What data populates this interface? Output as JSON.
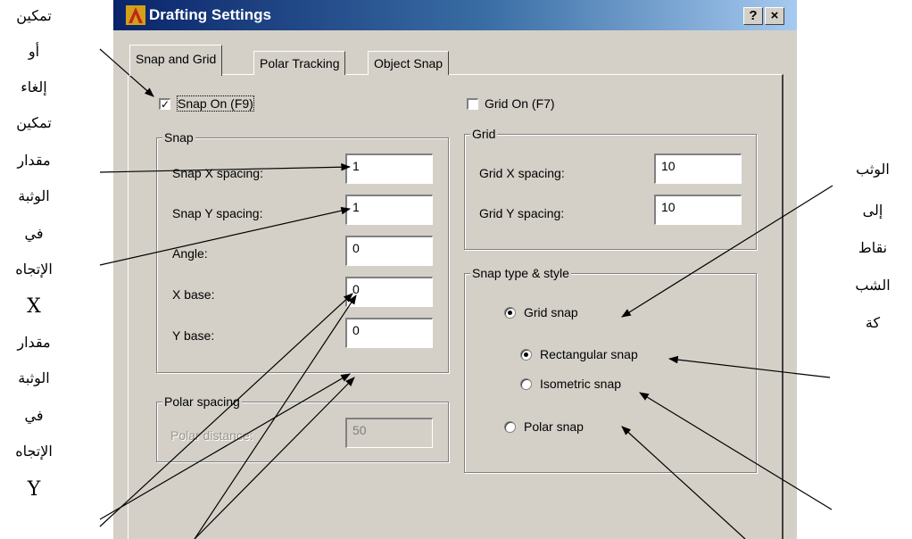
{
  "annotations": {
    "left": [
      "تمكين",
      "أو",
      "إلغاء",
      "تمكين",
      "مقدار",
      "الوثبة",
      "في",
      "الإتجاه",
      "X",
      "مقدار",
      "الوثبة",
      "في",
      "الإتجاه",
      "Y"
    ],
    "right": [
      "الوثب",
      "إلى",
      "نقاط",
      "الشب",
      "كة"
    ]
  },
  "window": {
    "title": "Drafting Settings",
    "help_button": "?",
    "close_button": "×"
  },
  "tabs": [
    {
      "label": "Snap and Grid",
      "active": true
    },
    {
      "label": "Polar Tracking",
      "active": false
    },
    {
      "label": "Object Snap",
      "active": false
    }
  ],
  "snap_on": {
    "label": "Snap On (F9)",
    "checked": true
  },
  "grid_on": {
    "label": "Grid On (F7)",
    "checked": false
  },
  "snap": {
    "title": "Snap",
    "x_spacing_label": "Snap X spacing:",
    "x_spacing": "1",
    "y_spacing_label": "Snap Y spacing:",
    "y_spacing": "1",
    "angle_label": "Angle:",
    "angle": "0",
    "x_base_label": "X base:",
    "x_base": "0",
    "y_base_label": "Y base:",
    "y_base": "0"
  },
  "grid": {
    "title": "Grid",
    "x_spacing_label": "Grid X spacing:",
    "x_spacing": "10",
    "y_spacing_label": "Grid Y spacing:",
    "y_spacing": "10"
  },
  "polar_spacing": {
    "title": "Polar spacing",
    "distance_label": "Polar distance:",
    "distance": "50"
  },
  "snap_type": {
    "title": "Snap type & style",
    "grid_snap": {
      "label": "Grid snap",
      "selected": true
    },
    "rectangular": {
      "label": "Rectangular snap",
      "selected": true
    },
    "isometric": {
      "label": "Isometric snap",
      "selected": false
    },
    "polar": {
      "label": "Polar snap",
      "selected": false
    }
  }
}
